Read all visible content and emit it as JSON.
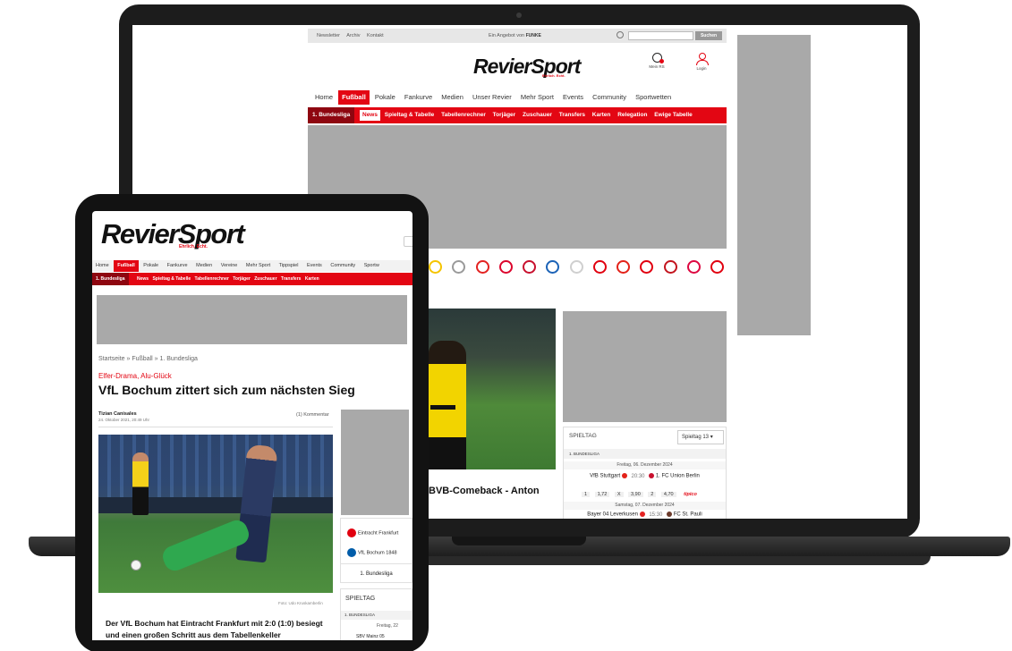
{
  "laptop": {
    "topbar": {
      "links": [
        "Newsletter",
        "Archiv",
        "Kontakt"
      ],
      "offer": "Ein Angebot von",
      "offer_brand": "FUNKE",
      "search_placeholder": "",
      "search_button": "Suchen"
    },
    "logo": "RevierSport",
    "logo_sub": "Ehrlich. Echt.",
    "mein_rs": "Mein RS",
    "login": "Login",
    "nav": [
      "Home",
      "Fußball",
      "Pokale",
      "Fankurve",
      "Medien",
      "Unser Revier",
      "Mehr Sport",
      "Events",
      "Community",
      "Sportwetten"
    ],
    "nav_active": "Fußball",
    "subnav_liga": "1. Bundesliga",
    "subnav": [
      "News",
      "Spieltag & Tabelle",
      "Tabellenrechner",
      "Torjäger",
      "Zuschauer",
      "Transfers",
      "Karten",
      "Relegation",
      "Ewige Tabelle"
    ],
    "subnav_active": "News",
    "club_colors": [
      "#f5c400",
      "#9a9a9a",
      "#e32221",
      "#dc052d",
      "#c8102e",
      "#1c63b7",
      "#cfcfcf",
      "#e1000f",
      "#e32219",
      "#e1000f",
      "#c3141e",
      "#dd0741",
      "#e1000f"
    ],
    "headline": "BVB-Comeback - Anton",
    "spieltag": {
      "title": "SPIELTAG",
      "select": "Spieltag 13",
      "liga": "1. BUNDESLIGA",
      "day1": "Freitag, 06. Dezember 2024",
      "match1_home": "VfB Stuttgart",
      "match1_time": "20:30",
      "match1_away": "1. FC Union Berlin",
      "odds": [
        "1",
        "1,72",
        "X",
        "3,90",
        "2",
        "4,70"
      ],
      "odds_brand": "tipico",
      "day2": "Samstag, 07. Dezember 2024",
      "match2_home": "Bayer 04 Leverkusen",
      "match2_time": "15:30",
      "match2_away": "FC St. Pauli"
    }
  },
  "tablet": {
    "logo": "RevierSport",
    "logo_sub": "Ehrlich. Echt.",
    "nav": [
      "Home",
      "Fußball",
      "Pokale",
      "Fankurve",
      "Medien",
      "Vereine",
      "Mehr Sport",
      "Tippspiel",
      "Events",
      "Community",
      "Sportw"
    ],
    "nav_active": "Fußball",
    "subnav_liga": "1. Bundesliga",
    "subnav": [
      "News",
      "Spieltag & Tabelle",
      "Tabellenrechner",
      "Torjäger",
      "Zuschauer",
      "Transfers",
      "Karten"
    ],
    "breadcrumb": "Startseite » Fußball » 1. Bundesliga",
    "kicker": "Elfer-Drama, Alu-Glück",
    "title": "VfL Bochum zittert sich zum nächsten Sieg",
    "author": "Tizian Canisales",
    "date": "24. Oktober 2021, 20:49 Uhr",
    "comments": "(1) Kommentar",
    "photo_caption": "Foto: Udo Kruskamberlin",
    "lead": "Der VfL Bochum hat Eintracht Frankfurt mit 2:0 (1:0) besiegt und einen großen Schritt aus dem Tabellenkeller",
    "teams": [
      "Eintracht Frankfurt",
      "VfL Bochum 1848"
    ],
    "liga_button": "1. Bundesliga",
    "spieltag": {
      "title": "SPIELTAG",
      "liga": "1. BUNDESLIGA",
      "day": "Freitag, 22",
      "match": "SBV Mainz 05"
    }
  }
}
